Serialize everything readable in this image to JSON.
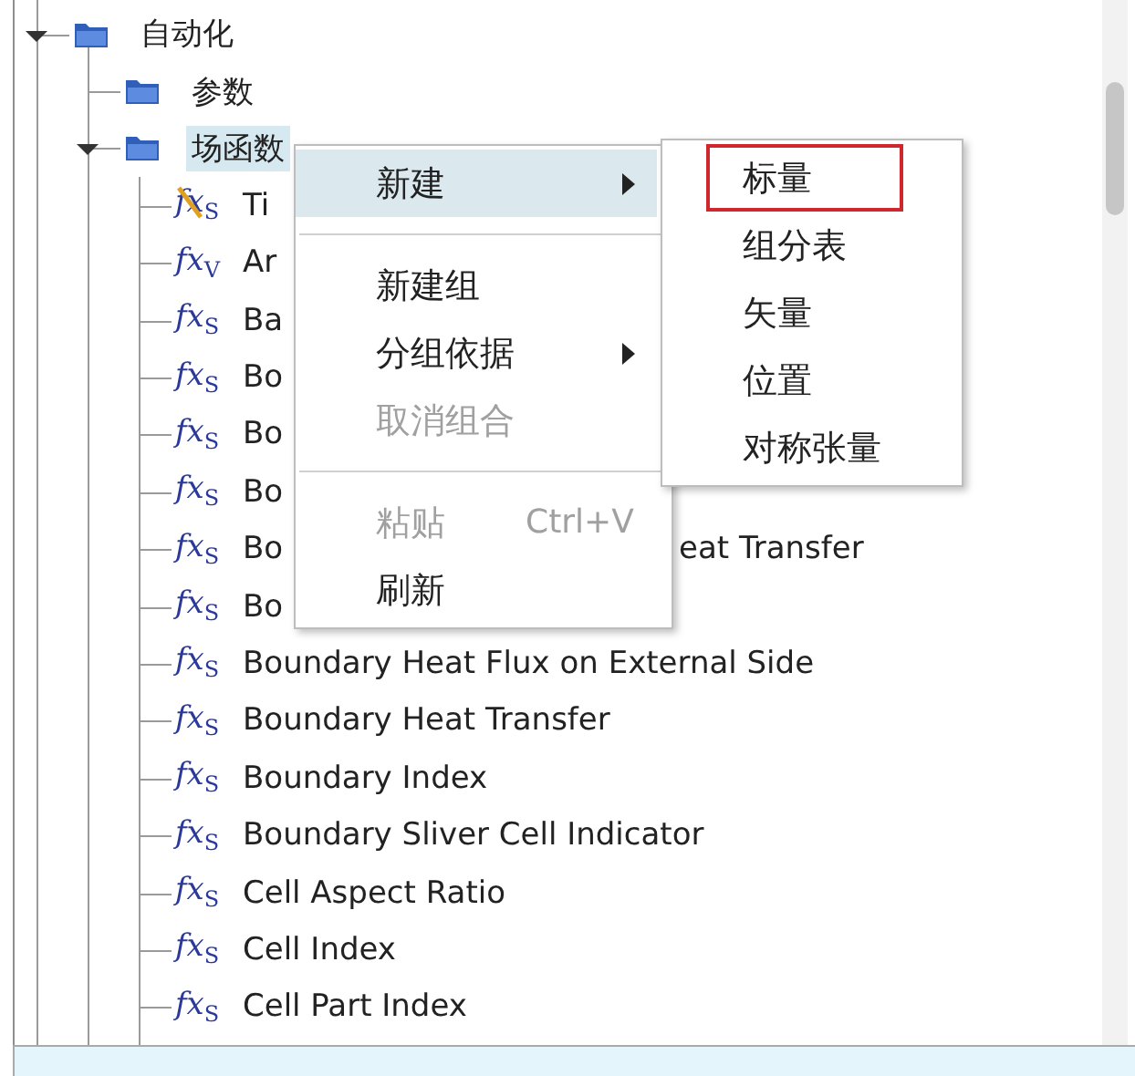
{
  "tree": {
    "items": [
      {
        "label": "自动化",
        "expanded": true,
        "selected": false,
        "children": [
          {
            "label": "参数",
            "selected": false
          },
          {
            "label": "场函数",
            "expanded": true,
            "selected": true,
            "children": [
              {
                "icon": "fx",
                "sub": "S",
                "crossed": true,
                "label": "Ti"
              },
              {
                "icon": "fx",
                "sub": "V",
                "crossed": false,
                "label": "Ar"
              },
              {
                "icon": "fx",
                "sub": "S",
                "crossed": false,
                "label": "Ba"
              },
              {
                "icon": "fx",
                "sub": "S",
                "crossed": false,
                "label": "Bo"
              },
              {
                "icon": "fx",
                "sub": "S",
                "crossed": false,
                "label": "Bo"
              },
              {
                "icon": "fx",
                "sub": "S",
                "crossed": false,
                "label": "Bo"
              },
              {
                "icon": "fx",
                "sub": "S",
                "crossed": false,
                "label": "Bo",
                "tail": "eat Transfer"
              },
              {
                "icon": "fx",
                "sub": "S",
                "crossed": false,
                "label": "Bo"
              },
              {
                "icon": "fx",
                "sub": "S",
                "crossed": false,
                "label": "Boundary Heat Flux on External Side"
              },
              {
                "icon": "fx",
                "sub": "S",
                "crossed": false,
                "label": "Boundary Heat Transfer"
              },
              {
                "icon": "fx",
                "sub": "S",
                "crossed": false,
                "label": "Boundary Index"
              },
              {
                "icon": "fx",
                "sub": "S",
                "crossed": false,
                "label": "Boundary Sliver Cell Indicator"
              },
              {
                "icon": "fx",
                "sub": "S",
                "crossed": false,
                "label": "Cell Aspect Ratio"
              },
              {
                "icon": "fx",
                "sub": "S",
                "crossed": false,
                "label": "Cell Index"
              },
              {
                "icon": "fx",
                "sub": "S",
                "crossed": false,
                "label": "Cell Part Index"
              }
            ]
          }
        ]
      }
    ]
  },
  "context_menu": {
    "items": [
      {
        "kind": "item",
        "label": "新建",
        "selected": true,
        "disabled": false,
        "submenu": true
      },
      {
        "kind": "separator"
      },
      {
        "kind": "item",
        "label": "新建组",
        "selected": false,
        "disabled": false,
        "submenu": false
      },
      {
        "kind": "item",
        "label": "分组依据",
        "selected": false,
        "disabled": false,
        "submenu": true
      },
      {
        "kind": "item",
        "label": "取消组合",
        "selected": false,
        "disabled": true,
        "submenu": false
      },
      {
        "kind": "separator"
      },
      {
        "kind": "item",
        "label": "粘贴",
        "shortcut": "Ctrl+V",
        "selected": false,
        "disabled": true,
        "submenu": false
      },
      {
        "kind": "item",
        "label": "刷新",
        "selected": false,
        "disabled": false,
        "submenu": false
      }
    ]
  },
  "submenu": {
    "items": [
      {
        "label": "标量",
        "outlined": true
      },
      {
        "label": "组分表",
        "outlined": false
      },
      {
        "label": "矢量",
        "outlined": false
      },
      {
        "label": "位置",
        "outlined": false
      },
      {
        "label": "对称张量",
        "outlined": false
      }
    ]
  }
}
